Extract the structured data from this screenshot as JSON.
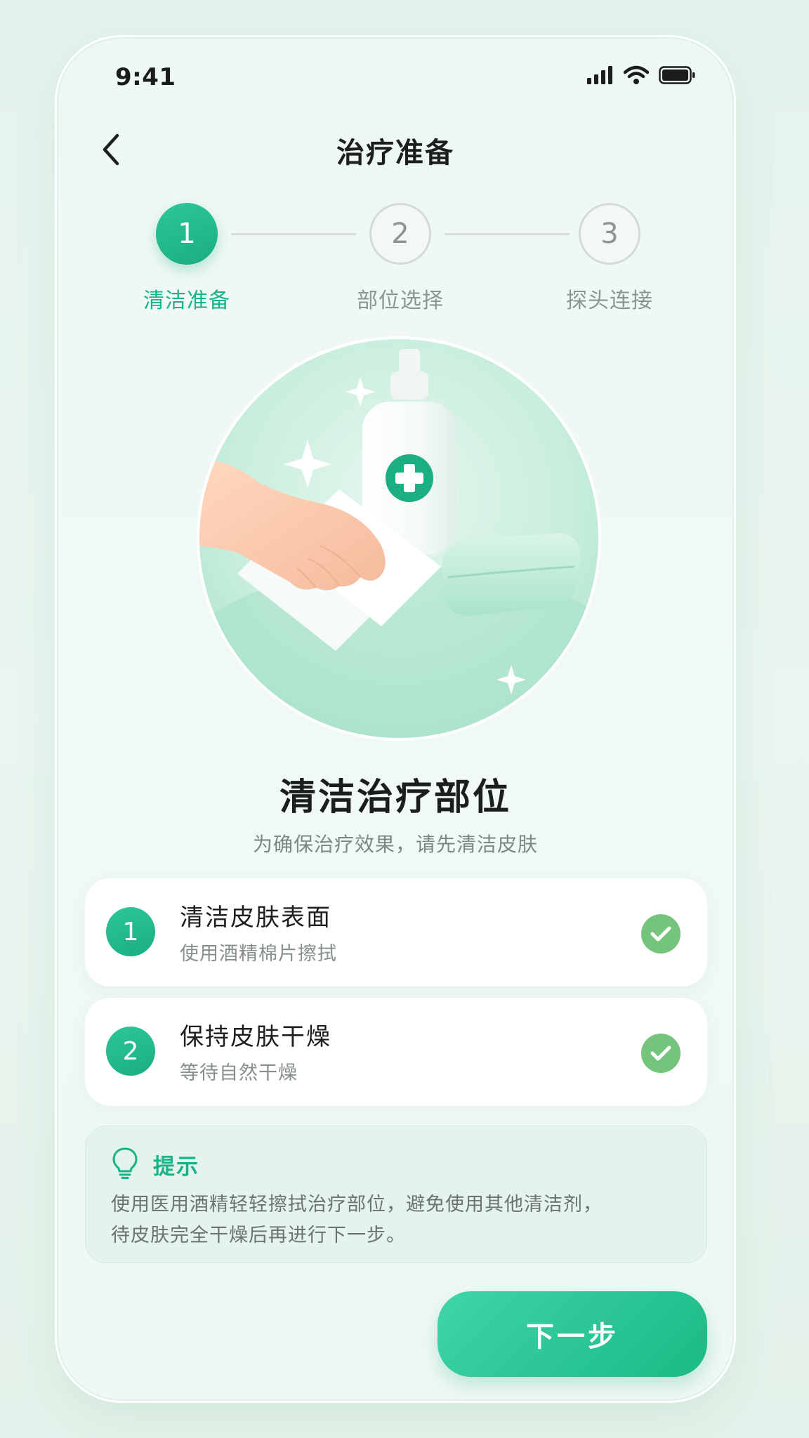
{
  "status_bar": {
    "time": "9:41"
  },
  "header": {
    "title": "治疗准备"
  },
  "stepper": {
    "steps": [
      {
        "number": "1",
        "label": "清洁准备",
        "state": "active"
      },
      {
        "number": "2",
        "label": "部位选择",
        "state": "inactive"
      },
      {
        "number": "3",
        "label": "探头连接",
        "state": "inactive"
      }
    ]
  },
  "main": {
    "title": "清洁治疗部位",
    "subtitle": "为确保治疗效果，请先清洁皮肤"
  },
  "tasks": [
    {
      "number": "1",
      "title": "清洁皮肤表面",
      "desc": "使用酒精棉片擦拭",
      "done": true
    },
    {
      "number": "2",
      "title": "保持皮肤干燥",
      "desc": "等待自然干燥",
      "done": true
    }
  ],
  "tip": {
    "title": "提示",
    "text_line1": "使用医用酒精轻轻擦拭治疗部位，避免使用其他清洁剂，",
    "text_line2": "待皮肤完全干燥后再进行下一步。"
  },
  "actions": {
    "next_label": "下一步"
  },
  "colors": {
    "accent": "#1ab388",
    "check": "#74c47b",
    "background": "#e9f5ef"
  },
  "icons": {
    "back": "chevron-left-icon",
    "tip": "lightbulb-icon",
    "check": "check-icon"
  }
}
